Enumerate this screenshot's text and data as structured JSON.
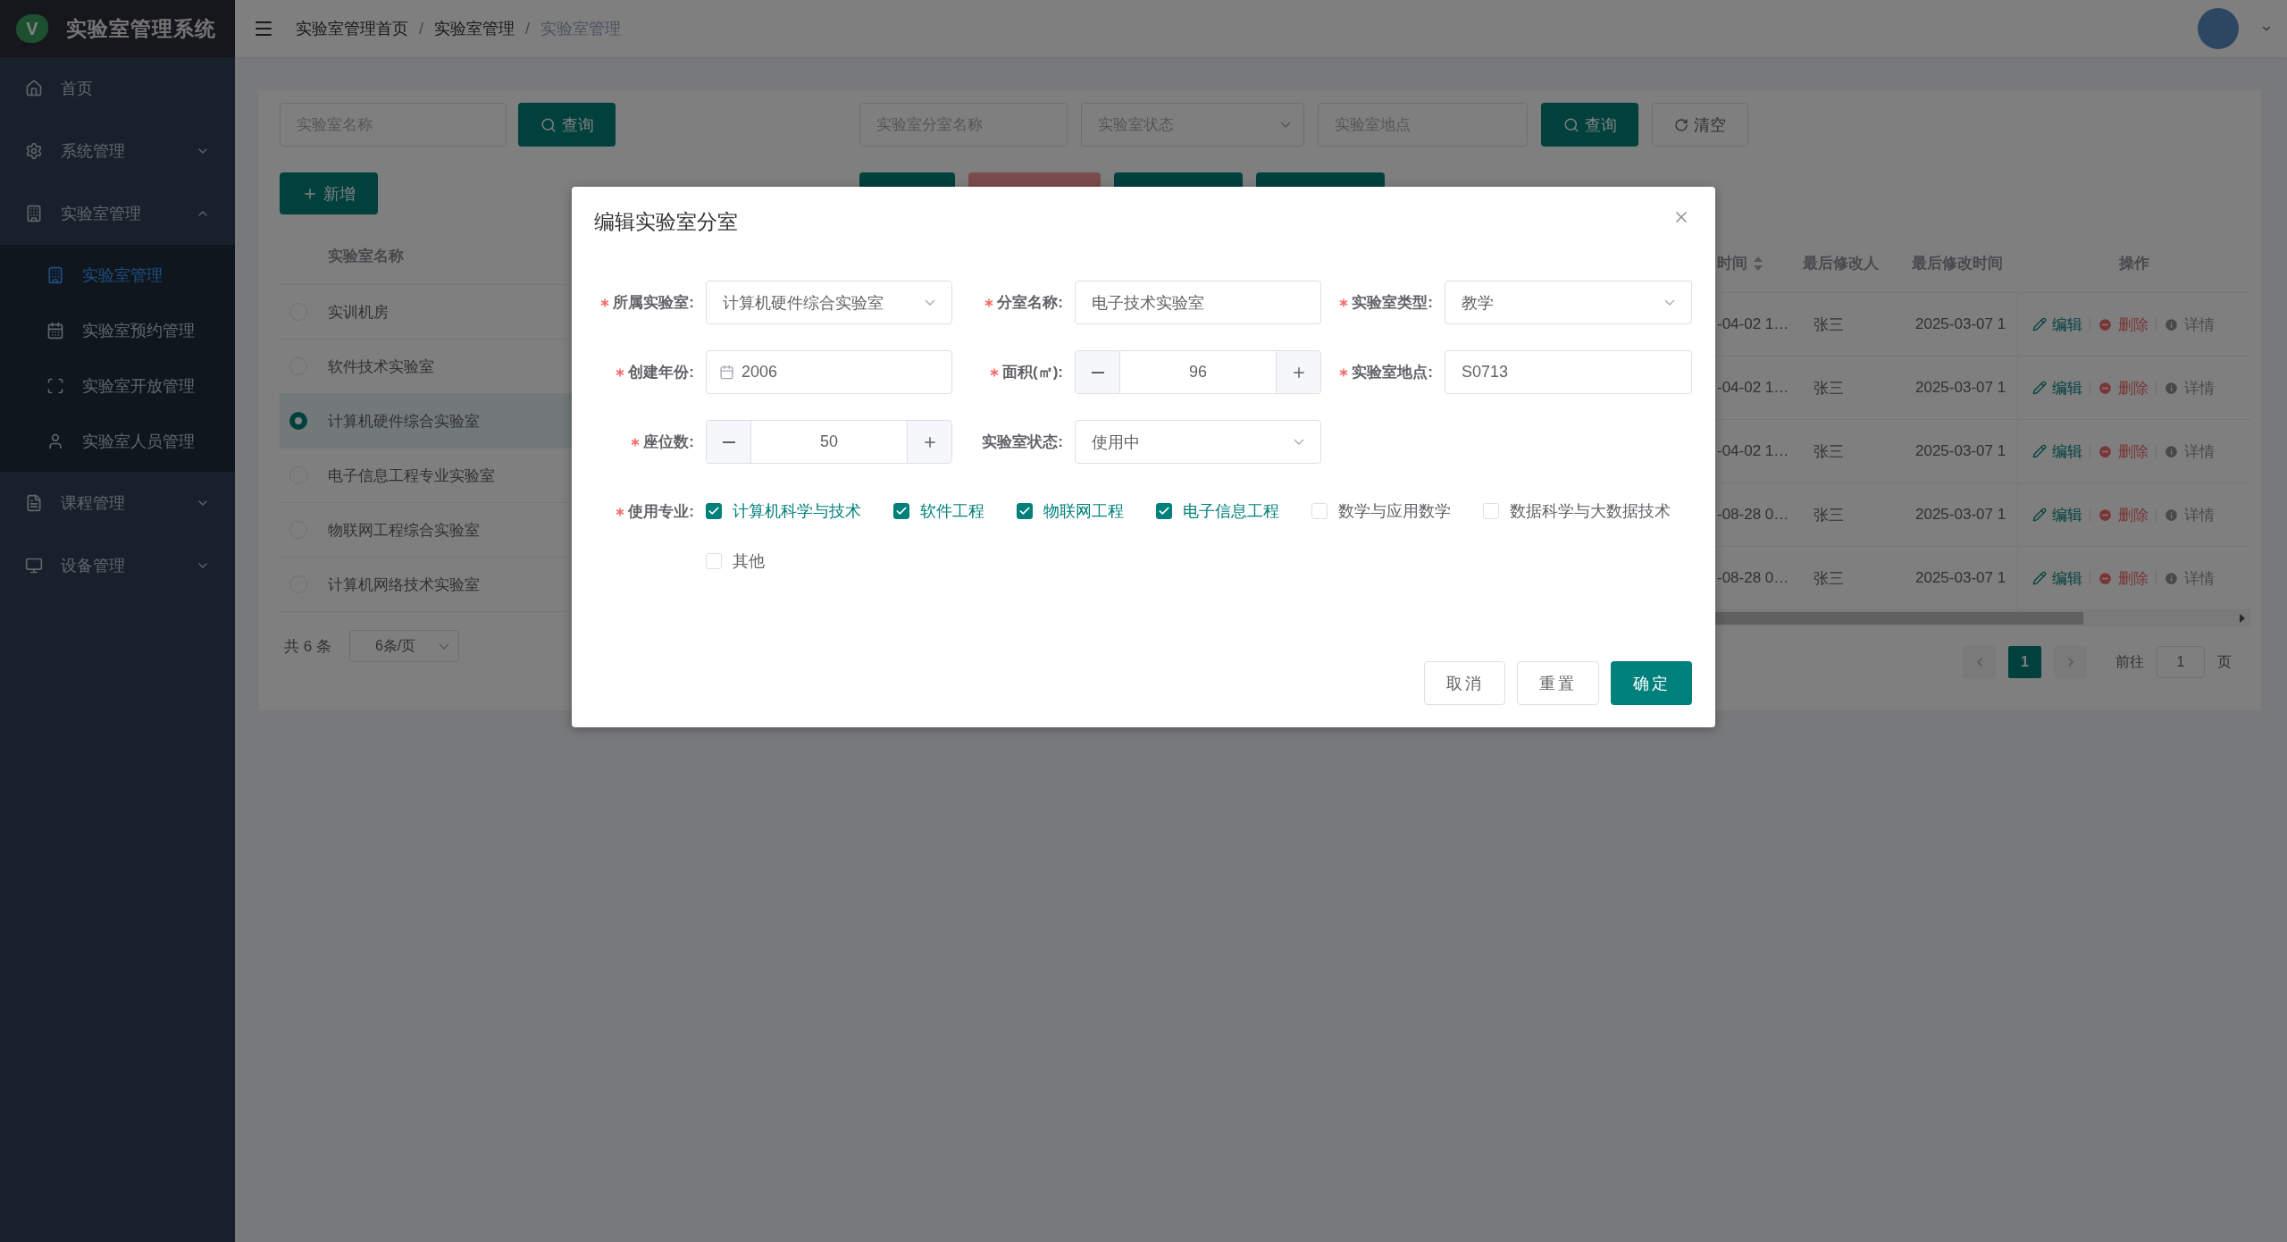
{
  "logo": {
    "mark": "V",
    "title": "实验室管理系统"
  },
  "menu": [
    {
      "kind": "link",
      "label": "首页"
    },
    {
      "kind": "group",
      "label": "系统管理",
      "expanded": false
    },
    {
      "kind": "group",
      "label": "实验室管理",
      "expanded": true,
      "children": [
        {
          "label": "实验室管理",
          "selected": true
        },
        {
          "label": "实验室预约管理",
          "selected": false
        },
        {
          "label": "实验室开放管理",
          "selected": false
        },
        {
          "label": "实验室人员管理",
          "selected": false
        }
      ]
    },
    {
      "kind": "group",
      "label": "课程管理",
      "expanded": false
    },
    {
      "kind": "group",
      "label": "设备管理",
      "expanded": false
    }
  ],
  "breadcrumb": [
    {
      "kind": "link",
      "text": "实验室管理首页"
    },
    {
      "kind": "separator",
      "text": "/"
    },
    {
      "kind": "link",
      "text": "实验室管理"
    },
    {
      "kind": "separator",
      "text": "/"
    },
    {
      "kind": "current",
      "text": "实验室管理"
    }
  ],
  "lab_panel": {
    "search": {
      "placeholder": "实验室名称"
    },
    "search_button": "查询",
    "add_button": "新增",
    "table": {
      "columns": [
        "实验室名称"
      ],
      "rows": [
        {
          "name": "实训机房",
          "selected": false
        },
        {
          "name": "软件技术实验室",
          "selected": false
        },
        {
          "name": "计算机硬件综合实验室",
          "selected": true
        },
        {
          "name": "电子信息工程专业实验室",
          "selected": false
        },
        {
          "name": "物联网工程综合实验室",
          "selected": false
        },
        {
          "name": "计算机网络技术实验室",
          "selected": false
        }
      ]
    },
    "total": "共 6 条",
    "page_size": "6条/页"
  },
  "room_panel": {
    "filters": [
      {
        "kind": "input",
        "placeholder": "实验室分室名称"
      },
      {
        "kind": "select",
        "placeholder": "实验室状态"
      },
      {
        "kind": "input",
        "placeholder": "实验室地点"
      }
    ],
    "search_button": "查询",
    "clear_button": "清空",
    "toolbar_buttons": [
      {
        "kind": "primary"
      },
      {
        "kind": "danger"
      },
      {
        "kind": "primary"
      },
      {
        "kind": "primary"
      }
    ],
    "table": {
      "columns": [
        "时间",
        "最后修改人",
        "最后修改时间",
        "操作"
      ],
      "rows": [
        {
          "column_1": "-04-02 1…",
          "modifier": "张三",
          "modified": "2025-03-07 1",
          "actions": [
            {
              "kind": "edit",
              "label": "编辑"
            },
            {
              "kind": "delete",
              "label": "删除"
            },
            {
              "kind": "detail",
              "label": "详情"
            }
          ]
        },
        {
          "column_1": "-04-02 1…",
          "modifier": "张三",
          "modified": "2025-03-07 1",
          "actions": [
            {
              "kind": "edit",
              "label": "编辑"
            },
            {
              "kind": "delete",
              "label": "删除"
            },
            {
              "kind": "detail",
              "label": "详情"
            }
          ]
        },
        {
          "column_1": "-04-02 1…",
          "modifier": "张三",
          "modified": "2025-03-07 1",
          "actions": [
            {
              "kind": "edit",
              "label": "编辑"
            },
            {
              "kind": "delete",
              "label": "删除"
            },
            {
              "kind": "detail",
              "label": "详情"
            }
          ]
        },
        {
          "column_1": "-08-28 0…",
          "modifier": "张三",
          "modified": "2025-03-07 1",
          "actions": [
            {
              "kind": "edit",
              "label": "编辑"
            },
            {
              "kind": "delete",
              "label": "删除"
            },
            {
              "kind": "detail",
              "label": "详情"
            }
          ]
        },
        {
          "column_1": "-08-28 0…",
          "modifier": "张三",
          "modified": "2025-03-07 1",
          "actions": [
            {
              "kind": "edit",
              "label": "编辑"
            },
            {
              "kind": "delete",
              "label": "删除"
            },
            {
              "kind": "detail",
              "label": "详情"
            }
          ]
        }
      ]
    },
    "pagination": {
      "pages": [
        {
          "label": "1",
          "selected": true
        }
      ],
      "goto_label": "前往",
      "goto_value": "1",
      "page_suffix": "页"
    }
  },
  "dialog": {
    "title": "编辑实验室分室",
    "fields": [
      {
        "kind": "select",
        "label": "所属实验室:",
        "value": "计算机硬件综合实验室",
        "required": true
      },
      {
        "kind": "text",
        "label": "分室名称:",
        "value": "电子技术实验室",
        "required": true
      },
      {
        "kind": "select",
        "label": "实验室类型:",
        "value": "教学",
        "required": true
      },
      {
        "kind": "date",
        "label": "创建年份:",
        "value": "2006",
        "required": true
      },
      {
        "kind": "number",
        "label": "面积(㎡):",
        "value": "96",
        "required": true
      },
      {
        "kind": "text",
        "label": "实验室地点:",
        "value": "S0713",
        "required": true
      },
      {
        "kind": "number",
        "label": "座位数:",
        "value": "50",
        "required": true
      },
      {
        "kind": "select",
        "label": "实验室状态:",
        "value": "使用中",
        "required": false
      }
    ],
    "majors": {
      "label": "使用专业:",
      "required": true,
      "options": [
        {
          "label": "计算机科学与技术",
          "checked": true
        },
        {
          "label": "软件工程",
          "checked": true
        },
        {
          "label": "物联网工程",
          "checked": true
        },
        {
          "label": "电子信息工程",
          "checked": true
        },
        {
          "label": "数学与应用数学",
          "checked": false
        },
        {
          "label": "数据科学与大数据技术",
          "checked": false
        },
        {
          "label": "其他",
          "checked": false
        }
      ]
    },
    "buttons": [
      {
        "kind": "default",
        "label": "取消"
      },
      {
        "kind": "default",
        "label": "重置"
      },
      {
        "kind": "primary",
        "label": "确定"
      }
    ]
  }
}
